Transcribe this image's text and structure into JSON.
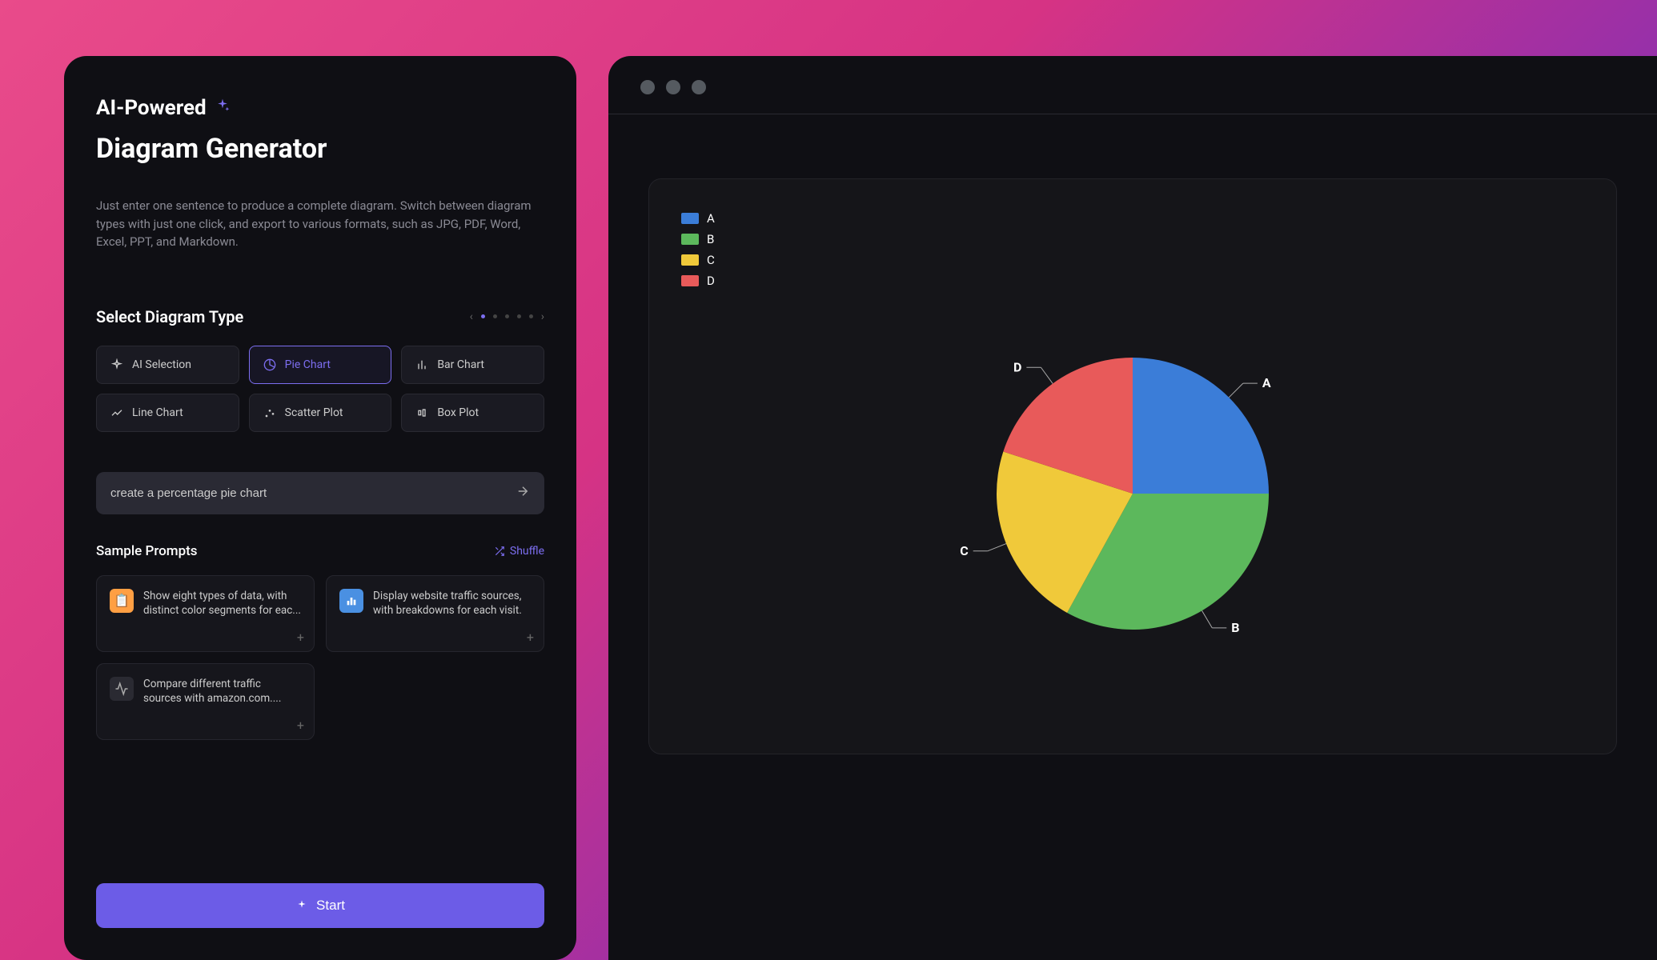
{
  "header": {
    "ai_powered": "AI-Powered",
    "title": "Diagram Generator",
    "description": "Just enter one sentence to produce a complete diagram. Switch between diagram types with just one click, and export to various formats, such as JPG, PDF, Word, Excel, PPT, and Markdown."
  },
  "select_type": {
    "title": "Select Diagram Type",
    "types": [
      {
        "label": "AI Selection",
        "icon": "sparkle"
      },
      {
        "label": "Pie Chart",
        "icon": "pie"
      },
      {
        "label": "Bar Chart",
        "icon": "bar"
      },
      {
        "label": "Line Chart",
        "icon": "line"
      },
      {
        "label": "Scatter Plot",
        "icon": "scatter"
      },
      {
        "label": "Box Plot",
        "icon": "box"
      }
    ],
    "selected_index": 1
  },
  "input": {
    "value": "create a percentage pie chart"
  },
  "samples": {
    "title": "Sample Prompts",
    "shuffle_label": "Shuffle",
    "prompts": [
      {
        "text": "Show eight types of data, with distinct color segments for eac...",
        "icon": "orange"
      },
      {
        "text": "Display website traffic sources, with breakdowns for each visit.",
        "icon": "blue"
      },
      {
        "text": "Compare different traffic sources with amazon.com....",
        "icon": "dark"
      }
    ]
  },
  "start_label": "Start",
  "chart_data": {
    "type": "pie",
    "legend_position": "top-left",
    "series": [
      {
        "name": "A",
        "value": 25,
        "color": "#3b7dd8"
      },
      {
        "name": "B",
        "value": 33,
        "color": "#5cb85c"
      },
      {
        "name": "C",
        "value": 22,
        "color": "#f0c93a"
      },
      {
        "name": "D",
        "value": 20,
        "color": "#e85a5a"
      }
    ]
  }
}
